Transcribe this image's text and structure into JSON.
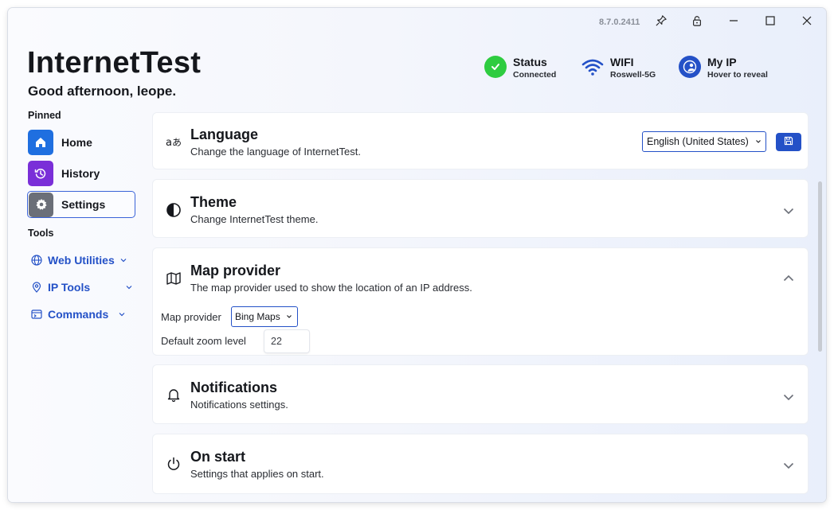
{
  "titlebar": {
    "version": "8.7.0.2411",
    "pin_icon": "pin-icon",
    "lock_icon": "lock-icon",
    "minimize_icon": "minimize-icon",
    "maximize_icon": "maximize-icon",
    "close_icon": "close-icon"
  },
  "header": {
    "app_title": "InternetTest",
    "greeting": "Good afternoon, leope."
  },
  "status": {
    "connection": {
      "title": "Status",
      "value": "Connected",
      "icon": "check-circle-icon",
      "color": "#2ecc40"
    },
    "wifi": {
      "title": "WIFI",
      "value": "Roswell-5G",
      "icon": "wifi-icon",
      "color": "#2451c7"
    },
    "ip": {
      "title": "My IP",
      "value": "Hover to reveal",
      "icon": "globe-person-icon",
      "color": "#2451c7"
    }
  },
  "sidebar": {
    "pinned_label": "Pinned",
    "items": [
      {
        "label": "Home",
        "icon": "home-icon",
        "color": "#1f6fe0"
      },
      {
        "label": "History",
        "icon": "history-icon",
        "color": "#7a2fd8"
      },
      {
        "label": "Settings",
        "icon": "gear-icon",
        "color": "#6b6f78",
        "active": true
      }
    ],
    "tools_label": "Tools",
    "tools": [
      {
        "label": "Web Utilities",
        "icon": "globe-icon"
      },
      {
        "label": "IP Tools",
        "icon": "location-pin-icon"
      },
      {
        "label": "Commands",
        "icon": "terminal-icon"
      }
    ]
  },
  "settings": {
    "language": {
      "title": "Language",
      "description": "Change the language of InternetTest.",
      "selected": "English (United States)",
      "icon": "translate-icon",
      "save_icon": "save-icon"
    },
    "theme": {
      "title": "Theme",
      "description": "Change InternetTest theme.",
      "icon": "contrast-icon"
    },
    "map_provider": {
      "title": "Map provider",
      "description": "The map provider used to show the location of an IP address.",
      "icon": "map-icon",
      "provider_label": "Map provider",
      "provider_value": "Bing Maps",
      "zoom_label": "Default zoom level",
      "zoom_value": "22"
    },
    "notifications": {
      "title": "Notifications",
      "description": "Notifications settings.",
      "icon": "bell-icon"
    },
    "on_start": {
      "title": "On start",
      "description": "Settings that applies on start.",
      "icon": "power-icon"
    }
  },
  "colors": {
    "accent": "#2451c7"
  }
}
